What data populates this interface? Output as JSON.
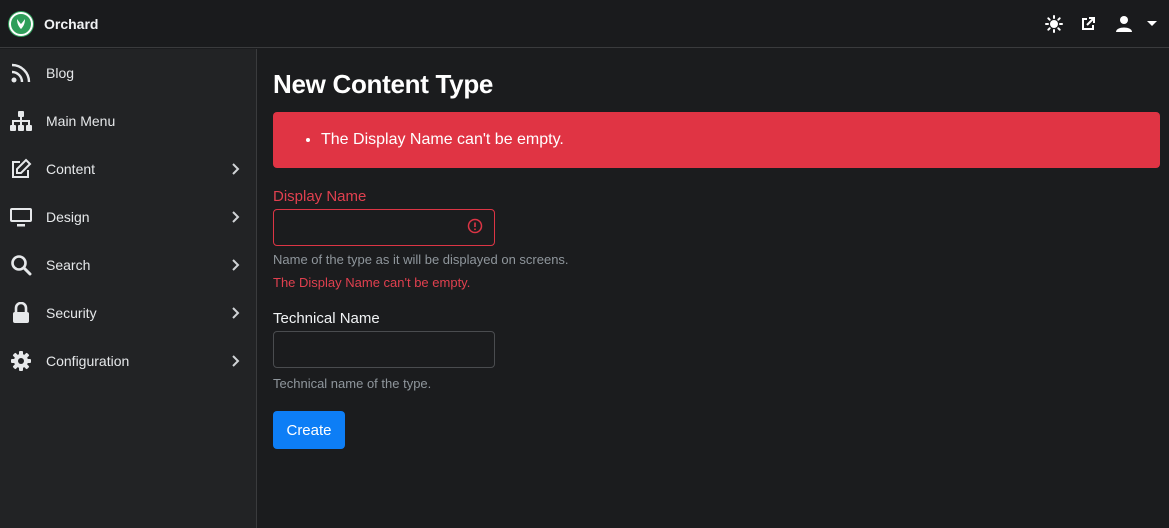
{
  "app": {
    "brand": "Orchard"
  },
  "header": {
    "icons": [
      "theme-toggle-icon",
      "external-link-icon",
      "user-icon"
    ]
  },
  "sidebar": {
    "items": [
      {
        "label": "Blog",
        "icon": "rss-icon",
        "has_children": false
      },
      {
        "label": "Main Menu",
        "icon": "sitemap-icon",
        "has_children": false
      },
      {
        "label": "Content",
        "icon": "edit-icon",
        "has_children": true
      },
      {
        "label": "Design",
        "icon": "monitor-icon",
        "has_children": true
      },
      {
        "label": "Search",
        "icon": "search-icon",
        "has_children": true
      },
      {
        "label": "Security",
        "icon": "lock-icon",
        "has_children": true
      },
      {
        "label": "Configuration",
        "icon": "gear-icon",
        "has_children": true
      }
    ]
  },
  "main": {
    "title": "New Content Type",
    "alert_message": "The Display Name can't be empty.",
    "display_name": {
      "label": "Display Name",
      "value": "",
      "help": "Name of the type as it will be displayed on screens.",
      "error": "The Display Name can't be empty."
    },
    "technical_name": {
      "label": "Technical Name",
      "value": "",
      "help": "Technical name of the type."
    },
    "create_label": "Create"
  },
  "colors": {
    "accent": "#0d7ef6",
    "danger": "#e03444",
    "brand": "#2f9e5a"
  }
}
